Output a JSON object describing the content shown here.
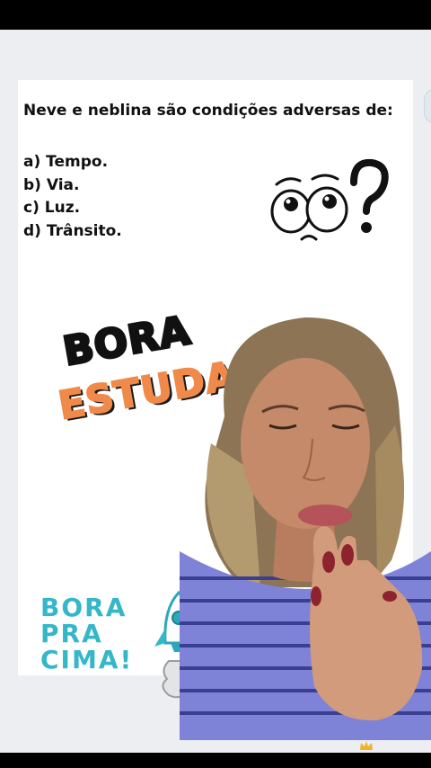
{
  "question": {
    "text": "Neve e neblina são condições adversas de:",
    "options": [
      "a) Tempo.",
      "b) Via.",
      "c) Luz.",
      "d) Trânsito."
    ]
  },
  "sticker_bora_estudar": {
    "line1": "BORA",
    "line2": "ESTUDAR"
  },
  "sticker_bora_pra_cima": {
    "lines": [
      "BORA",
      "PRA",
      "CIMA!"
    ]
  },
  "colors": {
    "accent_orange": "#f08a4b",
    "accent_teal": "#34b7c8",
    "shirt_stripe": "#7e83d8",
    "card_bg": "#ffffff",
    "stage_bg": "#eceef1"
  },
  "icons": [
    "confused-eyes-icon",
    "question-mark-icon",
    "rocket-icon",
    "crown-icon"
  ]
}
